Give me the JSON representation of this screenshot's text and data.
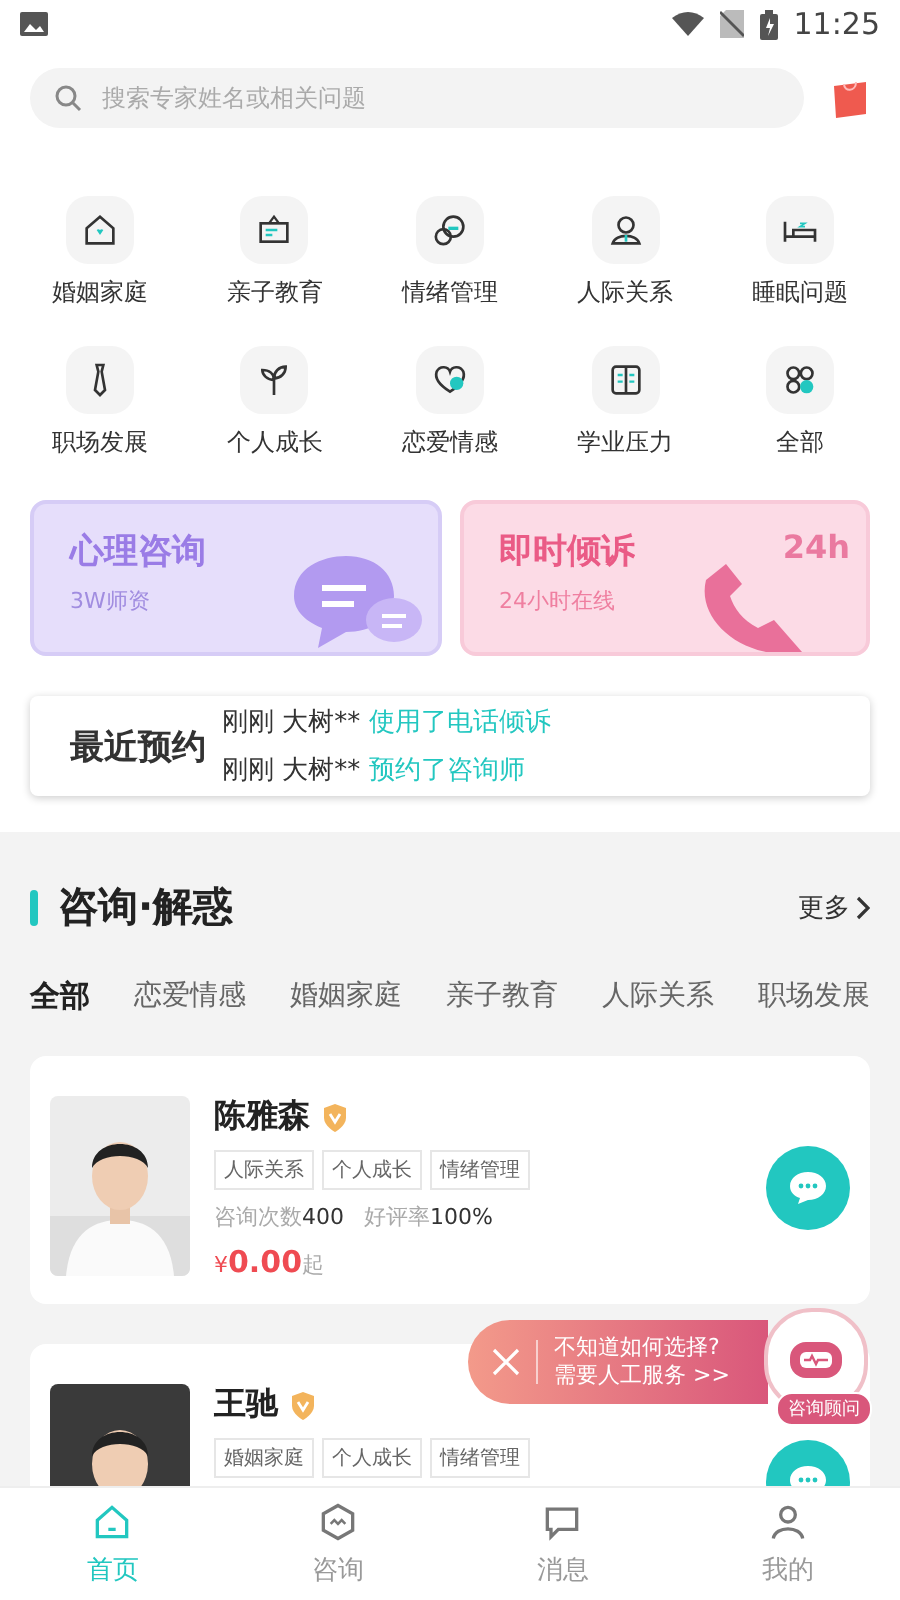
{
  "status_bar": {
    "time": "11:25"
  },
  "search": {
    "placeholder": "搜索专家姓名或相关问题"
  },
  "categories": [
    {
      "label": "婚姻家庭",
      "kind": "house"
    },
    {
      "label": "亲子教育",
      "kind": "board"
    },
    {
      "label": "情绪管理",
      "kind": "bubbles"
    },
    {
      "label": "人际关系",
      "kind": "person"
    },
    {
      "label": "睡眠问题",
      "kind": "bed"
    },
    {
      "label": "职场发展",
      "kind": "tie"
    },
    {
      "label": "个人成长",
      "kind": "sprout"
    },
    {
      "label": "恋爱情感",
      "kind": "heart"
    },
    {
      "label": "学业压力",
      "kind": "book"
    },
    {
      "label": "全部",
      "kind": "grid"
    }
  ],
  "banners": [
    {
      "title": "心理咨询",
      "subtitle": "3W师资",
      "kind": "consult"
    },
    {
      "title": "即时倾诉",
      "subtitle": "24小时在线",
      "kind": "hotline",
      "art_text": "24h"
    }
  ],
  "recent": {
    "title": "最近预约",
    "items": [
      {
        "who": "刚刚 大树**",
        "action": "使用了电话倾诉"
      },
      {
        "who": "刚刚 大树**",
        "action": "预约了咨询师"
      }
    ]
  },
  "section": {
    "title": "咨询·解惑",
    "more": "更多"
  },
  "filter_tabs": [
    {
      "label": "全部",
      "selected": true
    },
    {
      "label": "恋爱情感",
      "selected": false
    },
    {
      "label": "婚姻家庭",
      "selected": false
    },
    {
      "label": "亲子教育",
      "selected": false
    },
    {
      "label": "人际关系",
      "selected": false
    },
    {
      "label": "职场发展",
      "selected": false
    }
  ],
  "experts": [
    {
      "name": "陈雅森",
      "tags": [
        "人际关系",
        "个人成长",
        "情绪管理"
      ],
      "stats": [
        {
          "label": "咨询次数",
          "value": "400"
        },
        {
          "label": "好评率",
          "value": "100%"
        }
      ],
      "price": {
        "currency": "¥",
        "amount": "0.00",
        "suffix": "起"
      }
    },
    {
      "name": "王驰",
      "tags": [
        "婚姻家庭",
        "个人成长",
        "情绪管理"
      ]
    }
  ],
  "helper_popup": {
    "lines": [
      "不知道如何选择?",
      "需要人工服务 >>"
    ],
    "badge": "咨询顾问"
  },
  "bottom_nav": [
    {
      "label": "首页",
      "kind": "home",
      "selected": true
    },
    {
      "label": "咨询",
      "kind": "consult",
      "selected": false
    },
    {
      "label": "消息",
      "kind": "message",
      "selected": false
    },
    {
      "label": "我的",
      "kind": "me",
      "selected": false
    }
  ]
}
